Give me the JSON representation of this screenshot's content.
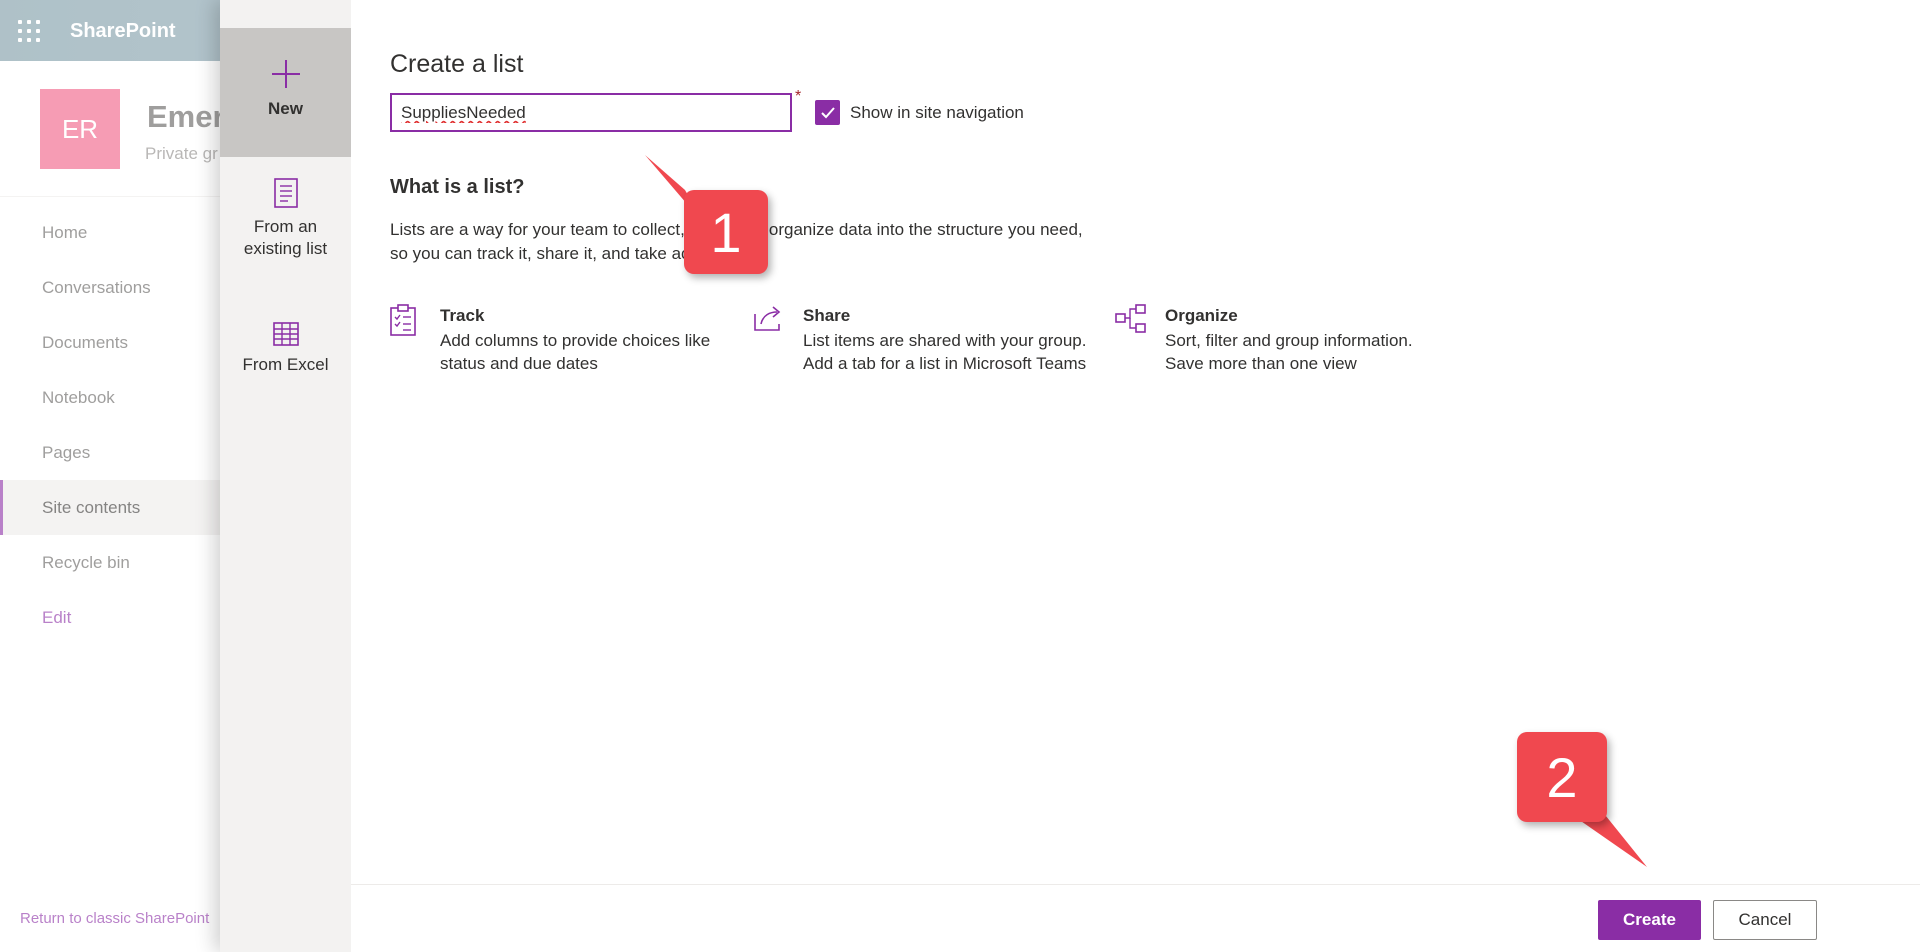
{
  "suite_bar": {
    "brand": "SharePoint"
  },
  "site": {
    "logo_initials": "ER",
    "title": "Emerg",
    "subtitle": "Private gr"
  },
  "left_nav": {
    "items": [
      {
        "label": "Home"
      },
      {
        "label": "Conversations"
      },
      {
        "label": "Documents"
      },
      {
        "label": "Notebook"
      },
      {
        "label": "Pages"
      },
      {
        "label": "Site contents",
        "selected": true
      },
      {
        "label": "Recycle bin"
      }
    ],
    "edit_label": "Edit",
    "classic_link": "Return to classic SharePoint"
  },
  "panel": {
    "rail": {
      "new_label": "New",
      "existing_label": "From an existing list",
      "excel_label": "From Excel"
    },
    "heading": "Create a list",
    "name_value": "SuppliesNeeded",
    "required_marker": "*",
    "show_in_nav_label": "Show in site navigation",
    "show_in_nav_checked": true,
    "what_heading": "What is a list?",
    "what_desc": "Lists are a way for your team to collect, track, and organize data into the structure you need, so you can track it, share it, and take action.",
    "features": [
      {
        "icon": "clipboard-checklist-icon",
        "title": "Track",
        "desc": "Add columns to provide choices like status and due dates"
      },
      {
        "icon": "share-icon",
        "title": "Share",
        "desc": "List items are shared with your group. Add a tab for a list in Microsoft Teams"
      },
      {
        "icon": "org-chart-icon",
        "title": "Organize",
        "desc": "Sort, filter and group information. Save more than one view"
      }
    ],
    "create_label": "Create",
    "cancel_label": "Cancel"
  },
  "annotations": {
    "step1": "1",
    "step2": "2",
    "color": "#f0484f"
  },
  "colors": {
    "accent": "#8a2da5",
    "site_logo": "#f05a82",
    "suite_bar": "#7a98a4"
  }
}
